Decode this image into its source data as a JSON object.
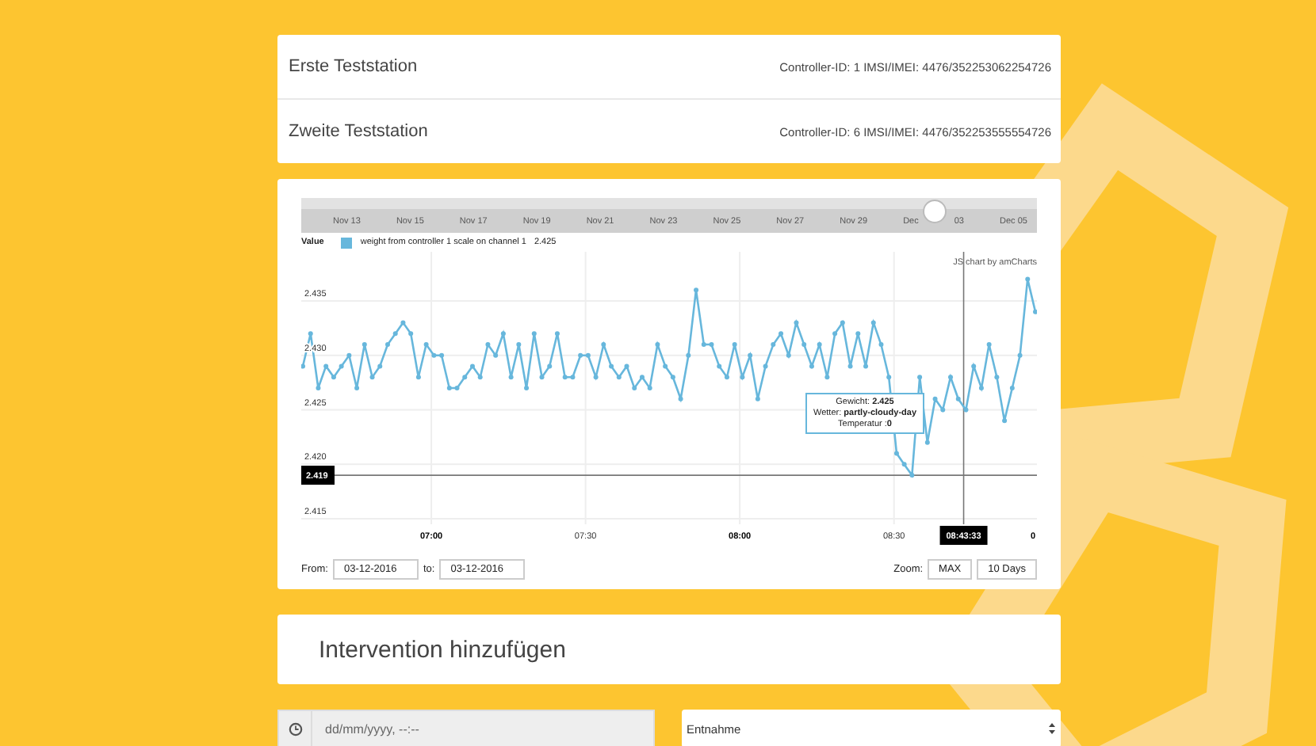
{
  "stations": [
    {
      "name": "Erste Teststation",
      "info": "Controller-ID: 1 IMSI/IMEI: 4476/352253062254726"
    },
    {
      "name": "Zweite Teststation",
      "info": "Controller-ID: 6 IMSI/IMEI: 4476/352253555554726"
    }
  ],
  "chart": {
    "navigator": {
      "labels": [
        "Nov 13",
        "Nov 15",
        "Nov 17",
        "Nov 19",
        "Nov 21",
        "Nov 23",
        "Nov 25",
        "Nov 27",
        "Nov 29",
        "Dec",
        "03",
        "Dec 05"
      ]
    },
    "legend": {
      "title": "Value",
      "value": "2.425"
    },
    "credit": "JS chart by amCharts",
    "chart_data": {
      "type": "line",
      "grid": true,
      "xlim": [
        395,
        537.5
      ],
      "ylim": [
        2.4145,
        2.4395
      ],
      "yticks": [
        {
          "value": 2.415,
          "label": "2.415"
        },
        {
          "value": 2.42,
          "label": "2.420"
        },
        {
          "value": 2.425,
          "label": "2.425"
        },
        {
          "value": 2.43,
          "label": "2.430"
        },
        {
          "value": 2.435,
          "label": "2.435"
        }
      ],
      "xticks": [
        {
          "value": 420,
          "label": "07:00"
        },
        {
          "value": 450,
          "label": "07:30"
        },
        {
          "value": 480,
          "label": "08:00"
        },
        {
          "value": 510,
          "label": "08:30"
        }
      ],
      "ref_lines": [
        {
          "axis": "y",
          "value": 2.419
        },
        {
          "axis": "x",
          "value": 523.55
        }
      ],
      "x": [
        395,
        396.5,
        398,
        399.5,
        401,
        402.5,
        404,
        405.5,
        407,
        408.5,
        410,
        411.5,
        413,
        414.5,
        416,
        417.5,
        419,
        420.5,
        422,
        423.5,
        425,
        426.5,
        428,
        429.5,
        431,
        432.5,
        434,
        435.5,
        437,
        438.5,
        440,
        441.5,
        443,
        444.5,
        446,
        447.5,
        449,
        450.5,
        452,
        453.5,
        455,
        456.5,
        458,
        459.5,
        461,
        462.5,
        464,
        465.5,
        467,
        468.5,
        470,
        471.5,
        473,
        474.5,
        476,
        477.5,
        479,
        480.5,
        482,
        483.5,
        485,
        486.5,
        488,
        489.5,
        491,
        492.5,
        494,
        495.5,
        497,
        498.5,
        500,
        501.5,
        503,
        504.5,
        506,
        507.5,
        509,
        510.5,
        512,
        513.5,
        515,
        516.5,
        518,
        519.5,
        521,
        522.5,
        524,
        525.5,
        527,
        528.5,
        530,
        531.5,
        533,
        534.5,
        536,
        537.5
      ],
      "series": [
        {
          "name": "weight from controller 1 scale on channel 1",
          "color": "#67b7dc",
          "marker": "circle",
          "values": [
            2.429,
            2.432,
            2.427,
            2.429,
            2.428,
            2.429,
            2.43,
            2.427,
            2.431,
            2.428,
            2.429,
            2.431,
            2.432,
            2.433,
            2.432,
            2.428,
            2.431,
            2.43,
            2.43,
            2.427,
            2.427,
            2.428,
            2.429,
            2.428,
            2.431,
            2.43,
            2.432,
            2.428,
            2.431,
            2.427,
            2.432,
            2.428,
            2.429,
            2.432,
            2.428,
            2.428,
            2.43,
            2.43,
            2.428,
            2.431,
            2.429,
            2.428,
            2.429,
            2.427,
            2.428,
            2.427,
            2.431,
            2.429,
            2.428,
            2.426,
            2.43,
            2.436,
            2.431,
            2.431,
            2.429,
            2.428,
            2.431,
            2.428,
            2.43,
            2.426,
            2.429,
            2.431,
            2.432,
            2.43,
            2.433,
            2.431,
            2.429,
            2.431,
            2.428,
            2.432,
            2.433,
            2.429,
            2.432,
            2.429,
            2.433,
            2.431,
            2.428,
            2.421,
            2.42,
            2.419,
            2.428,
            2.422,
            2.426,
            2.425,
            2.428,
            2.426,
            2.425,
            2.429,
            2.427,
            2.431,
            2.428,
            2.424,
            2.427,
            2.43,
            2.437,
            2.434
          ]
        }
      ]
    },
    "cursor": {
      "y_label": "2.419",
      "x_label": "08:43:33"
    },
    "x_edge_label": "0",
    "tooltip": {
      "lines": [
        "Gewicht: **2.425**",
        "Wetter: **partly-cloudy-day**",
        "Temperatur :**0**"
      ]
    },
    "from_label": "From:",
    "from_value": "03-12-2016",
    "to_label": "to:",
    "to_value": "03-12-2016",
    "zoom_label": "Zoom:",
    "zoom_buttons": [
      "MAX",
      "10 Days"
    ]
  },
  "intervention": {
    "title": "Intervention hinzufügen",
    "date_placeholder": "dd/mm/yyyy, --:--",
    "type_value": "Entnahme"
  }
}
